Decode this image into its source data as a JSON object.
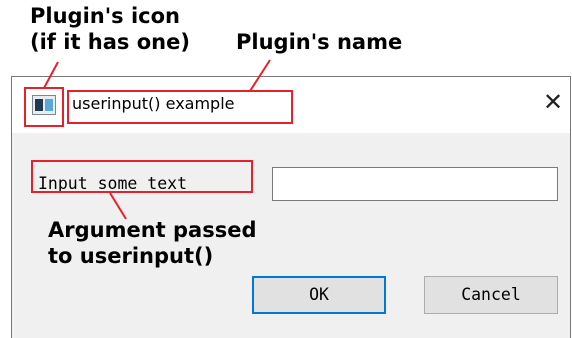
{
  "annotations": {
    "icon_line1": "Plugin's icon",
    "icon_line2": "(if it has one)",
    "name": "Plugin's name",
    "argument_line1": "Argument passed",
    "argument_line2": "to userinput()"
  },
  "dialog": {
    "icon": "plugin-window-icon",
    "title": "userinput() example",
    "close_glyph": "✕",
    "prompt": "Input some text",
    "input_value": "",
    "ok_label": "OK",
    "cancel_label": "Cancel"
  },
  "colors": {
    "highlight": "#e8202a",
    "focus_border": "#0078d7"
  }
}
